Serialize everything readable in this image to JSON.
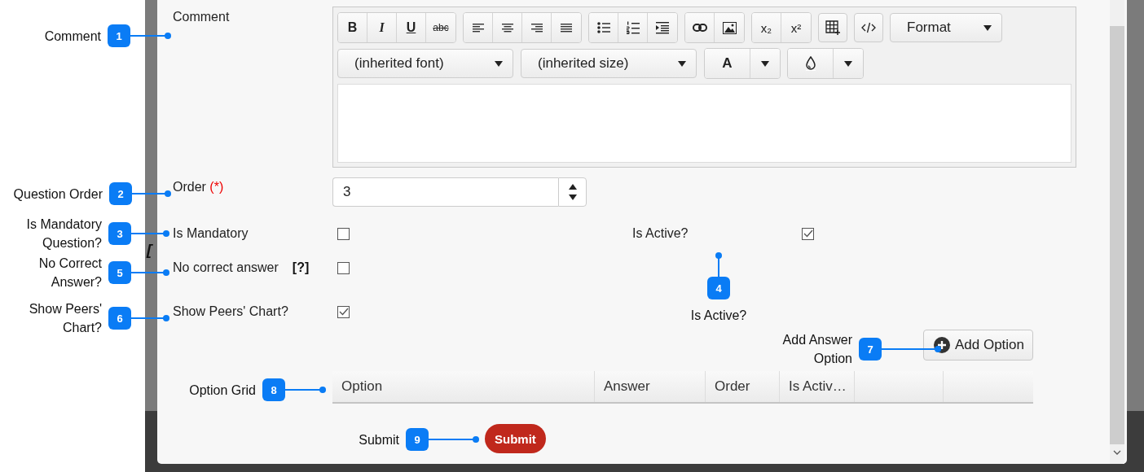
{
  "background_text": "[",
  "form": {
    "comment": {
      "label": "Comment",
      "format_buttons": [
        "B",
        "I",
        "U",
        "abc"
      ],
      "script_buttons": [
        "x₂",
        "x²"
      ],
      "format_dropdown": "Format",
      "font_dropdown": "(inherited font)",
      "size_dropdown": "(inherited size)",
      "text_color_glyph": "A"
    },
    "order": {
      "label": "Order",
      "required_mark": "(*)",
      "value": "3"
    },
    "is_mandatory": {
      "label": "Is Mandatory",
      "checked": false
    },
    "is_active": {
      "label": "Is Active?",
      "checked": true
    },
    "no_correct_answer": {
      "label": "No correct answer",
      "help": "[?]",
      "checked": false
    },
    "show_peers_chart": {
      "label": "Show Peers' Chart?",
      "checked": true
    },
    "add_option_button": "Add Option",
    "option_grid": {
      "columns": [
        "Option",
        "Answer",
        "Order",
        "Is Activ…"
      ]
    },
    "submit_button": "Submit"
  },
  "callouts": [
    {
      "number": "1",
      "label": "Comment"
    },
    {
      "number": "2",
      "label": "Question Order"
    },
    {
      "number": "3",
      "label": "Is Mandatory Question?"
    },
    {
      "number": "4",
      "label": "Is Active?"
    },
    {
      "number": "5",
      "label": "No Correct Answer?"
    },
    {
      "number": "6",
      "label": "Show Peers' Chart?"
    },
    {
      "number": "7",
      "label": "Add Answer Option"
    },
    {
      "number": "8",
      "label": "Option Grid"
    },
    {
      "number": "9",
      "label": "Submit"
    }
  ]
}
